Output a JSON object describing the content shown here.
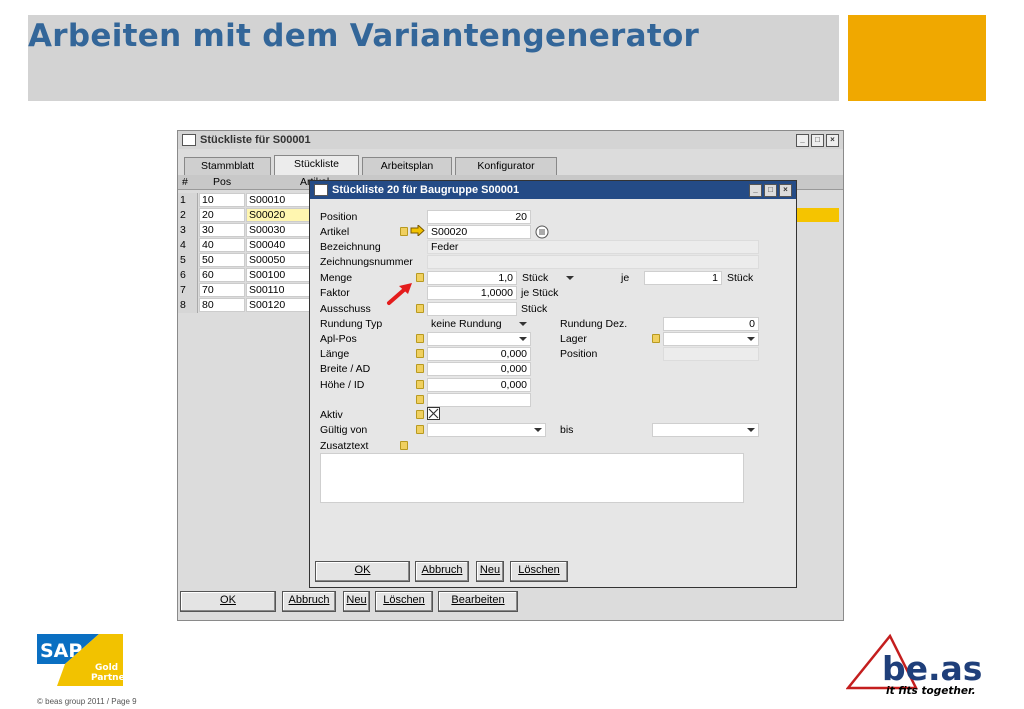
{
  "slide": {
    "title": "Arbeiten mit dem Variantengenerator",
    "accent_color": "#f0a800",
    "title_color": "#336699",
    "copyright": "© beas group 2011 / Page 9",
    "sap_logo": {
      "brand": "SAP",
      "badge_line1": "Gold",
      "badge_line2": "Partner"
    },
    "beas_logo": {
      "brand": "be.as",
      "tagline": "it fits together."
    }
  },
  "outer": {
    "title": "Stückliste für S00001",
    "tabs": [
      {
        "label": "Stammblatt"
      },
      {
        "label": "Stückliste"
      },
      {
        "label": "Arbeitsplan"
      },
      {
        "label": "Konfigurator"
      }
    ],
    "grid": {
      "headers": {
        "num": "#",
        "pos": "Pos",
        "artikel": "Artikel"
      },
      "rows": [
        {
          "num": "1",
          "pos": "10",
          "artikel": "S00010"
        },
        {
          "num": "2",
          "pos": "20",
          "artikel": "S00020"
        },
        {
          "num": "3",
          "pos": "30",
          "artikel": "S00030"
        },
        {
          "num": "4",
          "pos": "40",
          "artikel": "S00040"
        },
        {
          "num": "5",
          "pos": "50",
          "artikel": "S00050"
        },
        {
          "num": "6",
          "pos": "60",
          "artikel": "S00100"
        },
        {
          "num": "7",
          "pos": "70",
          "artikel": "S00110"
        },
        {
          "num": "8",
          "pos": "80",
          "artikel": "S00120"
        }
      ]
    },
    "buttons": {
      "ok": "OK",
      "abbruch": "Abbruch",
      "neu": "Neu",
      "loeschen": "Löschen",
      "bearbeiten": "Bearbeiten"
    }
  },
  "dialog": {
    "title": "Stückliste 20 für Baugruppe S00001",
    "labels": {
      "position": "Position",
      "artikel": "Artikel",
      "bezeichnung": "Bezeichnung",
      "zeichnungsnummer": "Zeichnungsnummer",
      "menge": "Menge",
      "faktor": "Faktor",
      "ausschuss": "Ausschuss",
      "rundung_typ": "Rundung Typ",
      "apl_pos": "Apl-Pos",
      "laenge": "Länge",
      "breite": "Breite / AD",
      "hoehe": "Höhe / ID",
      "aktiv": "Aktiv",
      "gueltig_von": "Gültig von",
      "zusatztext": "Zusatztext",
      "je": "je",
      "rundung_dez": "Rundung Dez.",
      "lager": "Lager",
      "position_r": "Position",
      "bis": "bis"
    },
    "values": {
      "position": "20",
      "artikel": "S00020",
      "bezeichnung": "Feder",
      "zeichnungsnummer": "",
      "menge": "1,0",
      "menge_unit": "Stück",
      "je_value": "1",
      "je_unit": "Stück",
      "faktor": "1,0000",
      "faktor_unit": "je Stück",
      "ausschuss": "",
      "ausschuss_unit": "Stück",
      "rundung_typ": "keine Rundung",
      "rundung_dez": "0",
      "apl_pos": "",
      "lager": "",
      "laenge": "0,000",
      "breite": "0,000",
      "hoehe": "0,000",
      "position_r": "",
      "extra": "",
      "gueltig_von": "",
      "bis": "",
      "zusatztext": "",
      "aktiv": true
    },
    "buttons": {
      "ok": "OK",
      "abbruch": "Abbruch",
      "neu": "Neu",
      "loeschen": "Löschen"
    }
  }
}
